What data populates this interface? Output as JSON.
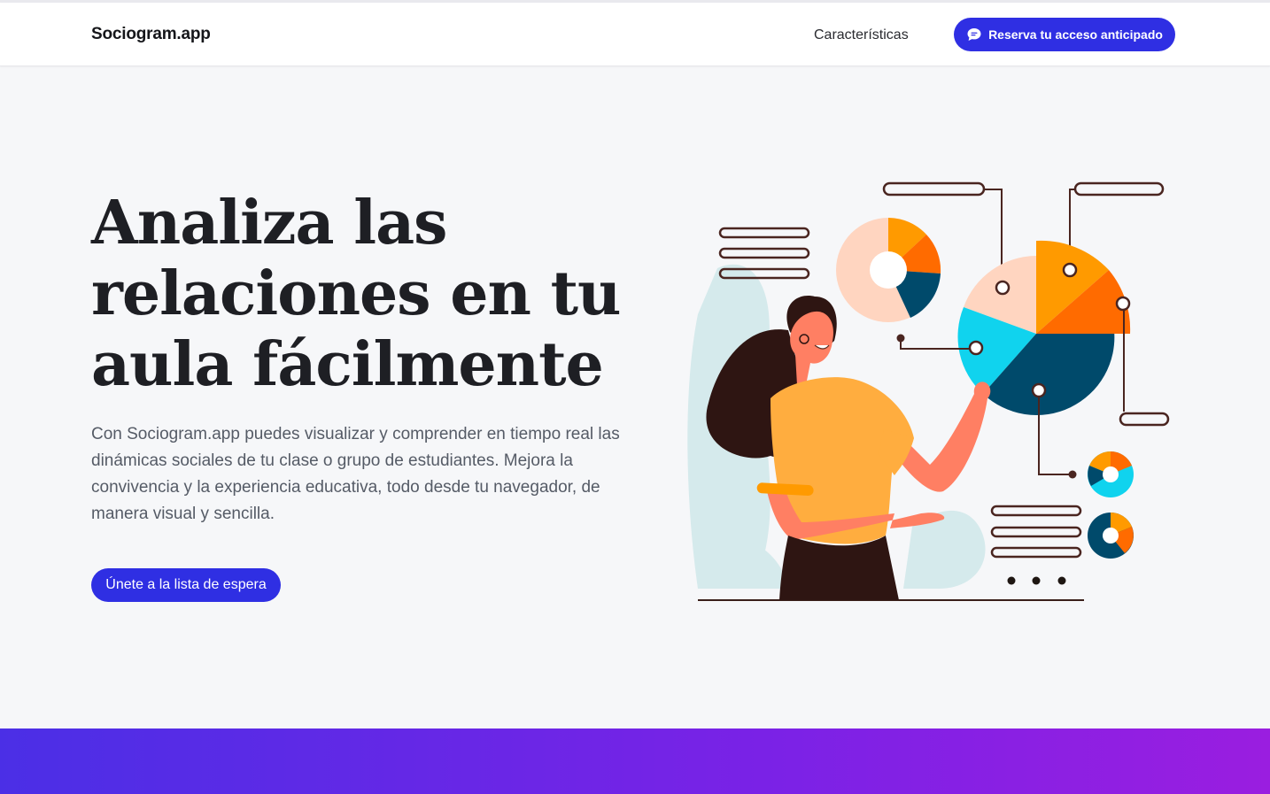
{
  "header": {
    "brand": "Sociogram.app",
    "nav_features": "Características",
    "cta_label": "Reserva tu acceso anticipado",
    "cta_icon": "chat-bubble-icon"
  },
  "hero": {
    "title": "Analiza las relaciones en tu aula fácilmente",
    "description": "Con Sociogram.app puedes visualizar y comprender en tiempo real las dinámicas sociales de tu clase o grupo de estudiantes. Mejora la convivencia y la experiencia educativa, todo desde tu navegador, de manera visual y sencilla.",
    "cta_label": "Únete a la lista de espera"
  },
  "colors": {
    "accent": "#2f2fe3",
    "illustration_orange": "#ff9a00",
    "illustration_red": "#ff6b00",
    "illustration_cyan": "#10d3ee",
    "illustration_navy": "#004a6b",
    "illustration_peach": "#ffd5c0"
  }
}
